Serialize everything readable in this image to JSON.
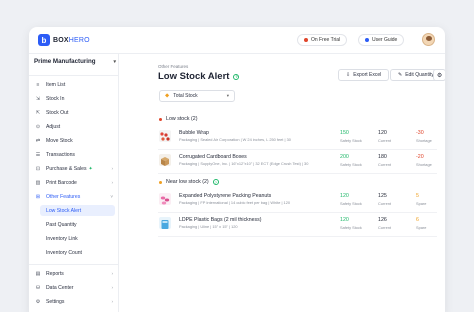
{
  "logo": {
    "part1": "BOX",
    "part2": "HERO"
  },
  "header": {
    "trial_label": "On Free Trial",
    "guide_label": "User Guide"
  },
  "colors": {
    "accent": "#2c5cf6",
    "safety": "#20b86a",
    "shortage": "#e0452b",
    "spare": "#f0a020"
  },
  "sidebar": {
    "workspace": "Prime Manufacturing",
    "items": [
      {
        "label": "Item List",
        "icon": "list-icon"
      },
      {
        "label": "Stock In",
        "icon": "stock-in-icon"
      },
      {
        "label": "Stock Out",
        "icon": "stock-out-icon"
      },
      {
        "label": "Adjust",
        "icon": "adjust-icon"
      },
      {
        "label": "Move Stock",
        "icon": "move-icon"
      },
      {
        "label": "Transactions",
        "icon": "transactions-icon"
      },
      {
        "label": "Purchase & Sales",
        "icon": "purchase-icon",
        "badge": "✦"
      },
      {
        "label": "Print Barcode",
        "icon": "barcode-icon"
      },
      {
        "label": "Other Features",
        "icon": "features-icon"
      }
    ],
    "subitems": [
      "Low Stock Alert",
      "Past Quantity",
      "Inventory Link",
      "Inventory Count"
    ],
    "bottom": [
      {
        "label": "Reports",
        "icon": "reports-icon"
      },
      {
        "label": "Data Center",
        "icon": "data-center-icon"
      },
      {
        "label": "Settings",
        "icon": "gear-icon"
      }
    ]
  },
  "main": {
    "breadcrumb": "Other Features",
    "title": "Low Stock Alert",
    "export_label": "Export Excel",
    "edit_label": "Edit Quantity",
    "filter_value": "Total Stock",
    "low_section": "Low stock (2)",
    "near_section": "Near low stock (2)",
    "col_safety": "Safety Stock",
    "col_current": "Current",
    "col_shortage": "Shortage",
    "col_spare": "Spare",
    "low_rows": [
      {
        "name": "Bubble Wrap",
        "meta": "Packaging | Sealed Air Corporation | W 24 inches, L 250 feet | 30",
        "safety": "150",
        "current": "120",
        "diff": "-30"
      },
      {
        "name": "Corrugated Cardboard Boxes",
        "meta": "Packaging | SupplyOne, Inc. | 16\"x12\"x10\" | 32 ECT (Edge Crush Test) | 30",
        "safety": "200",
        "current": "180",
        "diff": "-20"
      }
    ],
    "near_rows": [
      {
        "name": "Expanded Polystyrene Packing Peanuts",
        "meta": "Packaging | FP International | 14 cubic feet per bag | White | 120",
        "safety": "120",
        "current": "125",
        "diff": "5"
      },
      {
        "name": "LDPE Plastic Bags (2 mil thickness)",
        "meta": "Packaging | Uline | 15\" x 15\" | 120",
        "safety": "120",
        "current": "126",
        "diff": "6"
      }
    ]
  }
}
